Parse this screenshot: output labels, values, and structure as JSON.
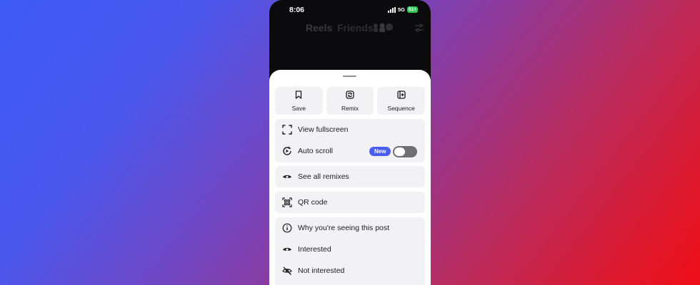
{
  "status_bar": {
    "time": "8:06",
    "network": "5G",
    "battery": "51+"
  },
  "top_nav": {
    "reels": "Reels",
    "friends": "Friends"
  },
  "actions": [
    {
      "label": "Save",
      "icon": "bookmark-icon"
    },
    {
      "label": "Remix",
      "icon": "remix-icon"
    },
    {
      "label": "Sequence",
      "icon": "sequence-icon"
    }
  ],
  "menu": {
    "view_fullscreen": "View fullscreen",
    "auto_scroll": "Auto scroll",
    "auto_scroll_badge": "New",
    "auto_scroll_enabled": false,
    "see_all_remixes": "See all remixes",
    "qr_code": "QR code",
    "why_seeing": "Why you're seeing this post",
    "interested": "Interested",
    "not_interested": "Not interested"
  },
  "colors": {
    "badge": "#4a5df2",
    "toggle_off": "#6e6e73",
    "sheet_bg": "#ffffff",
    "row_bg": "#f2f2f5",
    "battery": "#34c759"
  }
}
